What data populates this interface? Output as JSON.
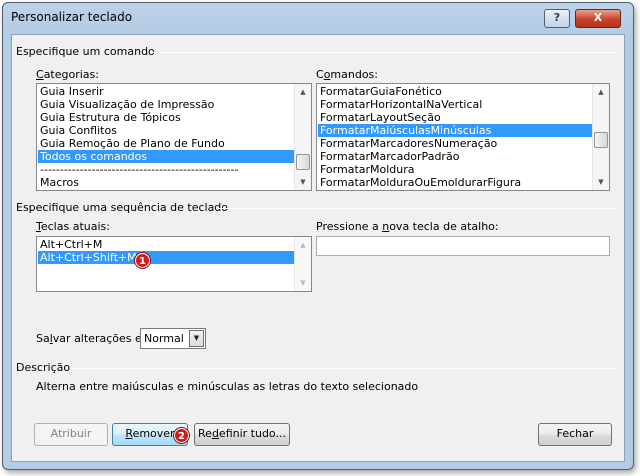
{
  "window": {
    "title": "Personalizar teclado",
    "help_label": "?",
    "close_label": "X"
  },
  "command_group": {
    "title": "Especifique um comando",
    "categories_label_u": "C",
    "categories_label_rest": "ategorias:",
    "categories": [
      "Guia Inserir",
      "Guia Visualização de Impressão",
      "Guia Estrutura de Tópicos",
      "Guia Conflitos",
      "Guia Remoção de Plano de Fundo",
      "Todos os comandos",
      "--------------------------------------------------",
      "Macros"
    ],
    "commands_label_u": "o",
    "commands_label_pre": "C",
    "commands_label_rest": "mandos:",
    "commands": [
      "FormatarGuiaFonético",
      "FormatarHorizontalNaVertical",
      "FormatarLayoutSeção",
      "FormatarMaiúsculasMinúsculas",
      "FormatarMarcadoresNumeração",
      "FormatarMarcadorPadrão",
      "FormatarMoldura",
      "FormatarMolduraOuEmoldurarFigura"
    ]
  },
  "keyboard_group": {
    "title": "Especifique uma sequência de teclado",
    "current_keys_label_u": "T",
    "current_keys_label_rest": "eclas atuais:",
    "current_keys": [
      "Alt+Ctrl+M",
      "Alt+Ctrl+Shift+M"
    ],
    "new_key_label_pre": "Pressione a ",
    "new_key_label_u": "n",
    "new_key_label_rest": "ova tecla de atalho:",
    "new_key_value": ""
  },
  "save": {
    "label_pre": "Sa",
    "label_u": "l",
    "label_rest": "var alterações em:",
    "value": "Normal"
  },
  "description": {
    "title": "Descrição",
    "text": "Alterna entre maiúsculas e minúsculas as letras do texto selecionado"
  },
  "buttons": {
    "assign": "Atribuir",
    "remove_u": "R",
    "remove_rest": "emover",
    "reset_pre": "Re",
    "reset_u": "d",
    "reset_rest": "efinir tudo...",
    "close": "Fechar"
  },
  "badges": {
    "first": "1",
    "second": "2"
  },
  "colors": {
    "selection": "#3399ff",
    "badge": "#cc1d1d"
  }
}
